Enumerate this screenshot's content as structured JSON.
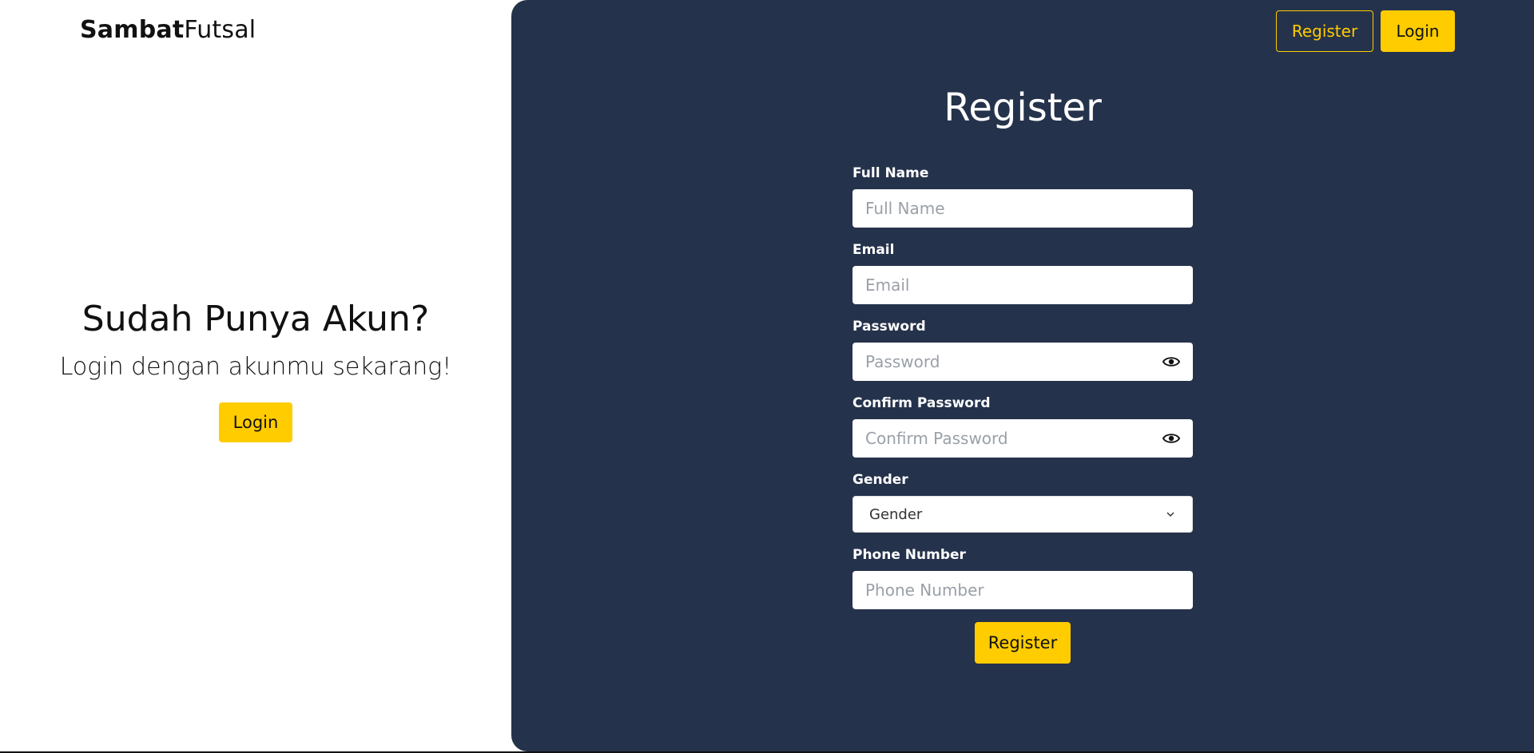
{
  "brand": {
    "part1": "Sambat",
    "part2": "Futsal"
  },
  "left": {
    "title": "Sudah Punya Akun?",
    "subtitle": "Login dengan akunmu sekarang!",
    "login_label": "Login"
  },
  "nav": {
    "register_label": "Register",
    "login_label": "Login"
  },
  "form": {
    "title": "Register",
    "full_name": {
      "label": "Full Name",
      "placeholder": "Full Name",
      "value": ""
    },
    "email": {
      "label": "Email",
      "placeholder": "Email",
      "value": ""
    },
    "password": {
      "label": "Password",
      "placeholder": "Password",
      "value": "",
      "icon": "eye-icon"
    },
    "confirm_password": {
      "label": "Confirm Password",
      "placeholder": "Confirm Password",
      "value": "",
      "icon": "eye-icon"
    },
    "gender": {
      "label": "Gender",
      "selected": "Gender",
      "icon": "chevron-down-icon"
    },
    "phone": {
      "label": "Phone Number",
      "placeholder": "Phone Number",
      "value": ""
    },
    "submit_label": "Register"
  },
  "colors": {
    "panel_bg": "#25324b",
    "accent": "#ffcc00",
    "page_bg": "#ffffff"
  }
}
